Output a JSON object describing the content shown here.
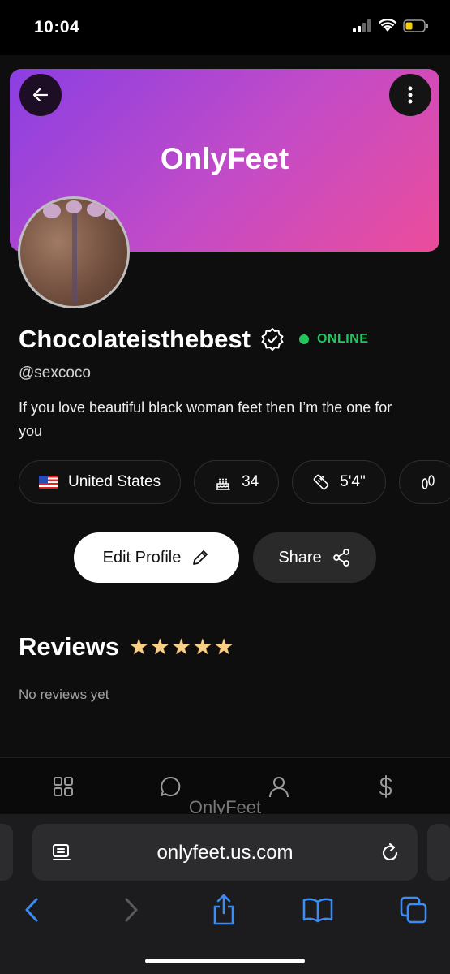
{
  "status_bar": {
    "time": "10:04"
  },
  "banner": {
    "title": "OnlyFeet"
  },
  "profile": {
    "username": "Chocolateisthebest",
    "online_status": "ONLINE",
    "handle": "@sexcoco",
    "bio": "If you love beautiful black woman feet then I’m the one for you"
  },
  "chips": {
    "country": "United States",
    "age": "34",
    "height": "5'4\""
  },
  "actions": {
    "edit_label": "Edit Profile",
    "share_label": "Share"
  },
  "reviews": {
    "title": "Reviews",
    "star_count": 5,
    "empty_text": "No reviews yet"
  },
  "nav": {
    "watermark": "OnlyFeet",
    "items": [
      "grid-icon",
      "chat-icon",
      "profile-icon",
      "dollar-icon"
    ]
  },
  "browser": {
    "url": "onlyfeet.us.com"
  },
  "colors": {
    "accent_start": "#8a3fe3",
    "accent_end": "#ec4c9a",
    "online": "#22c55e",
    "ios_blue": "#3b8cf5"
  }
}
